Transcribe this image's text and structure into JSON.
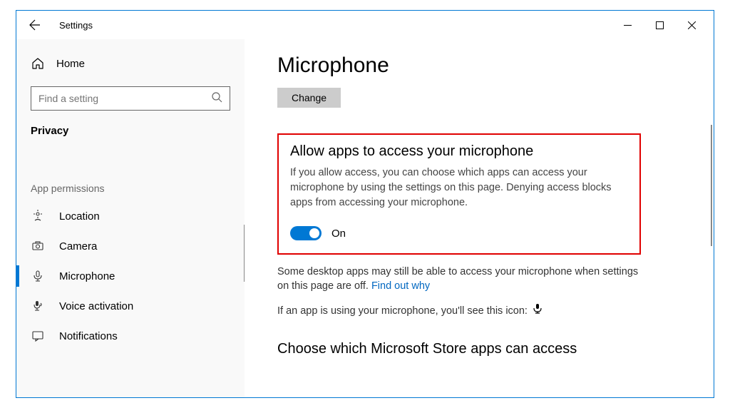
{
  "titlebar": {
    "title": "Settings"
  },
  "sidebar": {
    "home_label": "Home",
    "search_placeholder": "Find a setting",
    "category_label": "Privacy",
    "group_label": "App permissions",
    "items": [
      {
        "label": "Location"
      },
      {
        "label": "Camera"
      },
      {
        "label": "Microphone"
      },
      {
        "label": "Voice activation"
      },
      {
        "label": "Notifications"
      }
    ]
  },
  "main": {
    "page_title": "Microphone",
    "change_button": "Change",
    "allow_section": {
      "heading": "Allow apps to access your microphone",
      "description": "If you allow access, you can choose which apps can access your microphone by using the settings on this page. Denying access blocks apps from accessing your microphone.",
      "toggle_state": "On"
    },
    "desktop_note": "Some desktop apps may still be able to access your microphone when settings on this page are off. ",
    "find_out_why": "Find out why",
    "in_use_note": "If an app is using your microphone, you'll see this icon:",
    "choose_heading": "Choose which Microsoft Store apps can access"
  }
}
